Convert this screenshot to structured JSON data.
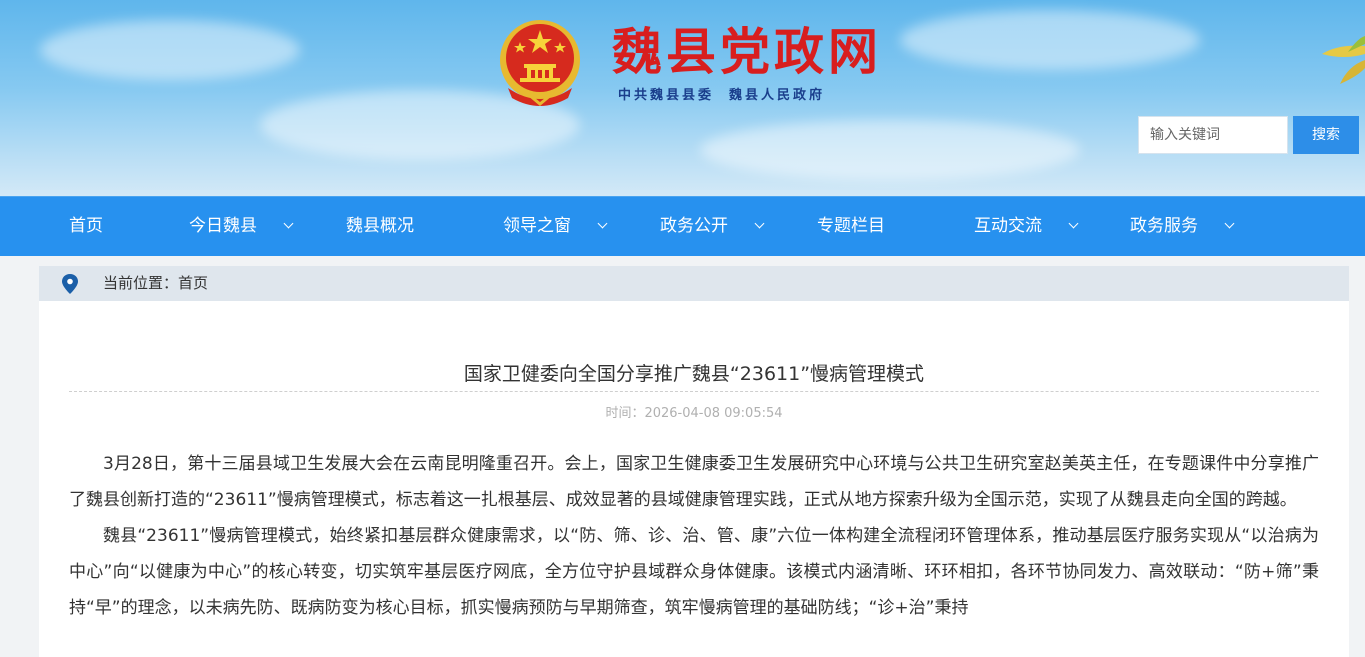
{
  "header": {
    "site_title": "魏县党政网",
    "site_subtitle": "中共魏县县委  魏县人民政府",
    "search_placeholder": "输入关键词",
    "search_button": "搜索"
  },
  "nav": {
    "items": [
      {
        "label": "首页"
      },
      {
        "label": "今日魏县"
      },
      {
        "label": "魏县概况"
      },
      {
        "label": "领导之窗"
      },
      {
        "label": "政务公开"
      },
      {
        "label": "专题栏目"
      },
      {
        "label": "互动交流"
      },
      {
        "label": "政务服务"
      }
    ]
  },
  "breadcrumb": {
    "text": "当前位置：首页"
  },
  "article": {
    "title": "国家卫健委向全国分享推广魏县“23611”慢病管理模式",
    "time": "时间：2026-04-08 09:05:54",
    "paragraphs": [
      "3月28日，第十三届县域卫生发展大会在云南昆明隆重召开。会上，国家卫生健康委卫生发展研究中心环境与公共卫生研究室赵美英主任，在专题课件中分享推广了魏县创新打造的“23611”慢病管理模式，标志着这一扎根基层、成效显著的县域健康管理实践，正式从地方探索升级为全国示范，实现了从魏县走向全国的跨越。",
      "魏县“23611”慢病管理模式，始终紧扣基层群众健康需求，以“防、筛、诊、治、管、康”六位一体构建全流程闭环管理体系，推动基层医疗服务实现从“以治病为中心”向“以健康为中心”的核心转变，切实筑牢基层医疗网底，全方位守护县域群众身体健康。该模式内涵清晰、环环相扣，各环节协同发力、高效联动：“防+筛”秉持“早”的理念，以未病先防、既病防变为核心目标，抓实慢病预防与早期筛查，筑牢慢病管理的基础防线；“诊+治”秉持"
    ]
  },
  "colors": {
    "nav_bg": "#2791ef",
    "search_button_bg": "#2d8ee8",
    "title_red": "#d81e1e",
    "subtitle_blue": "#1a3e8c"
  },
  "icons": {
    "emblem": "national-emblem-icon",
    "location": "location-pin-icon",
    "dropdown": "chevron-down-icon"
  }
}
